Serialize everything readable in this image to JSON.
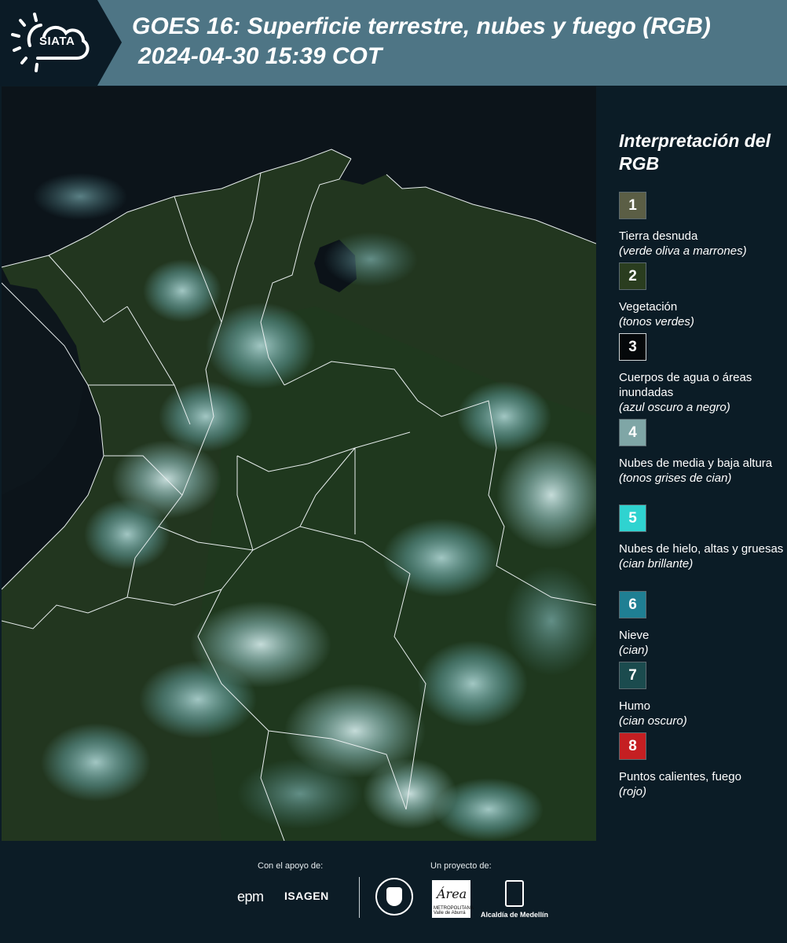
{
  "header": {
    "logo_text": "SIATA",
    "title": "GOES 16: Superficie terrestre, nubes y fuego (RGB)",
    "subtitle": "2024-04-30 15:39 COT"
  },
  "legend": {
    "title": "Interpretación del RGB",
    "items": [
      {
        "number": "1",
        "label": "Tierra desnuda",
        "note": "(verde oliva a marrones)",
        "color": "#5b5e45"
      },
      {
        "number": "2",
        "label": "Vegetación",
        "note": "(tonos verdes)",
        "color": "#2a3d1f"
      },
      {
        "number": "3",
        "label": "Cuerpos de agua o áreas inundadas",
        "note": "(azul oscuro a negro)",
        "color": "#05080a"
      },
      {
        "number": "4",
        "label": "Nubes de media y baja altura",
        "note": "(tonos grises de cian)",
        "color": "#7fa6a6"
      },
      {
        "number": "5",
        "label": "Nubes de hielo, altas y gruesas",
        "note": "(cian brillante)",
        "color": "#2fd3d0"
      },
      {
        "number": "6",
        "label": "Nieve",
        "note": "(cian)",
        "color": "#1f7f93"
      },
      {
        "number": "7",
        "label": "Humo",
        "note": "(cian oscuro)",
        "color": "#1b4b4e"
      },
      {
        "number": "8",
        "label": "Puntos calientes, fuego",
        "note": "(rojo)",
        "color": "#c51f22"
      }
    ]
  },
  "footer": {
    "support_label": "Con el apoyo de:",
    "project_label": "Un proyecto de:",
    "epm": "epm",
    "isagen": "ISAGEN",
    "area_logo": "Área",
    "area_small": "METROPOLITANA Valle de Aburrá",
    "medellin": "Alcaldía de Medellín"
  }
}
